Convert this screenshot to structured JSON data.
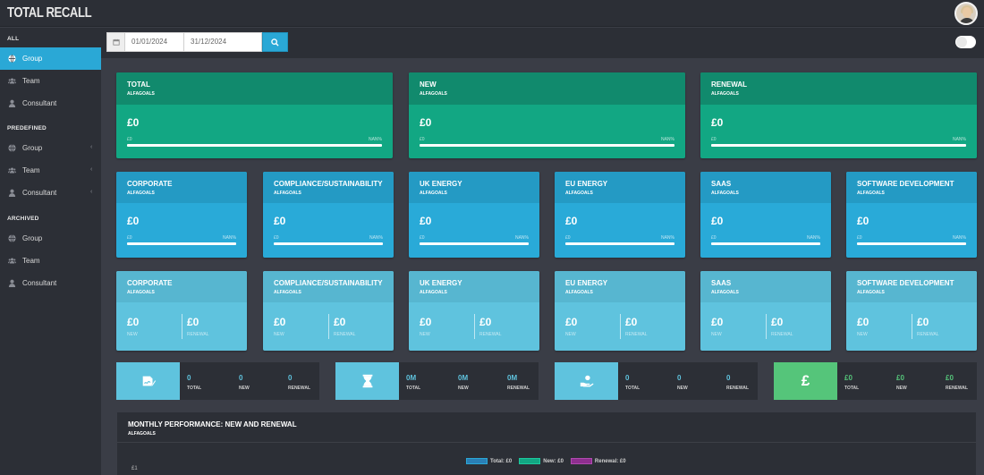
{
  "app": {
    "title": "TOTAL RECALL"
  },
  "sidebar": {
    "sections": [
      {
        "header": "ALL",
        "items": [
          {
            "label": "Group",
            "icon": "globe-icon",
            "active": true
          },
          {
            "label": "Team",
            "icon": "users-icon"
          },
          {
            "label": "Consultant",
            "icon": "user-icon"
          }
        ]
      },
      {
        "header": "PREDEFINED",
        "items": [
          {
            "label": "Group",
            "icon": "globe-icon",
            "chevron": "‹"
          },
          {
            "label": "Team",
            "icon": "users-icon",
            "chevron": "‹"
          },
          {
            "label": "Consultant",
            "icon": "user-icon",
            "chevron": "‹"
          }
        ]
      },
      {
        "header": "ARCHIVED",
        "items": [
          {
            "label": "Group",
            "icon": "globe-icon"
          },
          {
            "label": "Team",
            "icon": "users-icon"
          },
          {
            "label": "Consultant",
            "icon": "user-icon"
          }
        ]
      }
    ]
  },
  "filters": {
    "start_date": "01/01/2024",
    "end_date": "31/12/2024"
  },
  "top_cards": [
    {
      "title": "TOTAL",
      "subtitle": "ALFAGOALS",
      "value": "£0",
      "zero": "£0",
      "pct": "NAN%"
    },
    {
      "title": "NEW",
      "subtitle": "ALFAGOALS",
      "value": "£0",
      "zero": "£0",
      "pct": "NAN%"
    },
    {
      "title": "RENEWAL",
      "subtitle": "ALFAGOALS",
      "value": "£0",
      "zero": "£0",
      "pct": "NAN%"
    }
  ],
  "sector_cards": [
    {
      "title": "CORPORATE",
      "subtitle": "ALFAGOALS",
      "value": "£0",
      "zero": "£0",
      "pct": "NAN%"
    },
    {
      "title": "COMPLIANCE/SUSTAINABILITY",
      "subtitle": "ALFAGOALS",
      "value": "£0",
      "zero": "£0",
      "pct": "NAN%"
    },
    {
      "title": "UK ENERGY",
      "subtitle": "ALFAGOALS",
      "value": "£0",
      "zero": "£0",
      "pct": "NAN%"
    },
    {
      "title": "EU ENERGY",
      "subtitle": "ALFAGOALS",
      "value": "£0",
      "zero": "£0",
      "pct": "NAN%"
    },
    {
      "title": "SAAS",
      "subtitle": "ALFAGOALS",
      "value": "£0",
      "zero": "£0",
      "pct": "NAN%"
    },
    {
      "title": "SOFTWARE DEVELOPMENT",
      "subtitle": "ALFAGOALS",
      "value": "£0",
      "zero": "£0",
      "pct": "NAN%"
    }
  ],
  "split_cards": [
    {
      "title": "CORPORATE",
      "subtitle": "ALFAGOALS",
      "new_value": "£0",
      "new_label": "NEW",
      "renewal_value": "£0",
      "renewal_label": "RENEWAL"
    },
    {
      "title": "COMPLIANCE/SUSTAINABILITY",
      "subtitle": "ALFAGOALS",
      "new_value": "£0",
      "new_label": "NEW",
      "renewal_value": "£0",
      "renewal_label": "RENEWAL"
    },
    {
      "title": "UK ENERGY",
      "subtitle": "ALFAGOALS",
      "new_value": "£0",
      "new_label": "NEW",
      "renewal_value": "£0",
      "renewal_label": "RENEWAL"
    },
    {
      "title": "EU ENERGY",
      "subtitle": "ALFAGOALS",
      "new_value": "£0",
      "new_label": "NEW",
      "renewal_value": "£0",
      "renewal_label": "RENEWAL"
    },
    {
      "title": "SAAS",
      "subtitle": "ALFAGOALS",
      "new_value": "£0",
      "new_label": "NEW",
      "renewal_value": "£0",
      "renewal_label": "RENEWAL"
    },
    {
      "title": "SOFTWARE DEVELOPMENT",
      "subtitle": "ALFAGOALS",
      "new_value": "£0",
      "new_label": "NEW",
      "renewal_value": "£0",
      "renewal_label": "RENEWAL"
    }
  ],
  "stats": [
    {
      "icon": "signature-icon",
      "color": "#5fc3de",
      "value_color": "#5fc3de",
      "items": [
        {
          "value": "0",
          "label": "TOTAL"
        },
        {
          "value": "0",
          "label": "NEW"
        },
        {
          "value": "0",
          "label": "RENEWAL"
        }
      ]
    },
    {
      "icon": "hourglass-icon",
      "color": "#5fc3de",
      "value_color": "#5fc3de",
      "items": [
        {
          "value": "0M",
          "label": "TOTAL"
        },
        {
          "value": "0M",
          "label": "NEW"
        },
        {
          "value": "0M",
          "label": "RENEWAL"
        }
      ]
    },
    {
      "icon": "hand-coin-icon",
      "color": "#5fc3de",
      "value_color": "#5fc3de",
      "items": [
        {
          "value": "0",
          "label": "TOTAL"
        },
        {
          "value": "0",
          "label": "NEW"
        },
        {
          "value": "0",
          "label": "RENEWAL"
        }
      ]
    },
    {
      "icon": "pound-icon",
      "glyph": "£",
      "color": "#55c57a",
      "value_color": "#55c57a",
      "items": [
        {
          "value": "£0",
          "label": "TOTAL"
        },
        {
          "value": "£0",
          "label": "NEW"
        },
        {
          "value": "£0",
          "label": "RENEWAL"
        }
      ]
    }
  ],
  "monthly": {
    "title": "MONTHLY PERFORMANCE: NEW AND RENEWAL",
    "subtitle": "ALFAGOALS",
    "y_tick": "£1",
    "legend": [
      {
        "label": "Total: £0",
        "color": "#2a7fb5",
        "border": "#2aa8d6"
      },
      {
        "label": "New: £0",
        "color": "#12a783",
        "border": "#1cc99d"
      },
      {
        "label": "Renewal: £0",
        "color": "#8e2f8f",
        "border": "#b04ab0"
      }
    ]
  }
}
